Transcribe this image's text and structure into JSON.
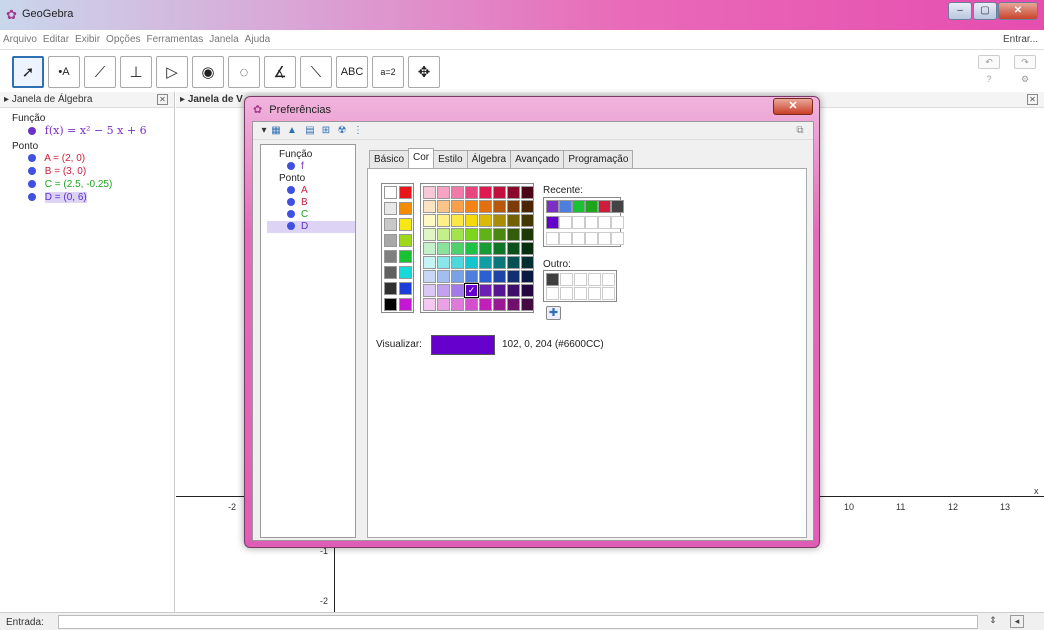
{
  "app": {
    "title": "GeoGebra",
    "login": "Entrar..."
  },
  "menu": [
    "Arquivo",
    "Editar",
    "Exibir",
    "Opções",
    "Ferramentas",
    "Janela",
    "Ajuda"
  ],
  "toolbar": {
    "text_tool": "ABC",
    "slider_tool": "a=2"
  },
  "algebra": {
    "title": "Janela de Álgebra",
    "groups": [
      {
        "label": "Função",
        "items": [
          {
            "text": "f(x) = x² − 5 x + 6",
            "color": "#7b2fc5"
          }
        ]
      },
      {
        "label": "Ponto",
        "items": [
          {
            "text": "A = (2, 0)",
            "color": "#cc1d3c"
          },
          {
            "text": "B = (3, 0)",
            "color": "#cc1d3c"
          },
          {
            "text": "C = (2.5, -0.25)",
            "color": "#1ea51e"
          },
          {
            "text": "D = (0, 6)",
            "color": "#5b2fd0"
          }
        ]
      }
    ]
  },
  "graphics": {
    "title": "Janela de V",
    "x_ticks": [
      "-2",
      "10",
      "11",
      "12",
      "13"
    ],
    "y_ticks": [
      "-1",
      "-2"
    ],
    "x_axis_label": "x"
  },
  "input": {
    "label": "Entrada:"
  },
  "dialog": {
    "title": "Preferências",
    "tree": [
      {
        "label": "Função",
        "children": [
          "f"
        ]
      },
      {
        "label": "Ponto",
        "children": [
          "A",
          "B",
          "C",
          "D"
        ]
      }
    ],
    "tabs": [
      "Básico",
      "Cor",
      "Estilo",
      "Álgebra",
      "Avançado",
      "Programação"
    ],
    "selected_tab": "Cor",
    "recent_label": "Recente:",
    "other_label": "Outro:",
    "preview_label": "Visualizar:",
    "preview_value": "102, 0, 204 (#6600CC)",
    "preview_color": "#6600cc",
    "gray_colors": [
      "#ffffff",
      "#e8e8e8",
      "#c8c8c8",
      "#a8a8a8",
      "#808080",
      "#606060",
      "#303030",
      "#000000"
    ],
    "primary_colors": [
      "#e8161b",
      "#f38c00",
      "#f7e714",
      "#9bd91a",
      "#19c233",
      "#17d9d9",
      "#1b3ed9",
      "#c416d3"
    ],
    "palette_rows": [
      [
        "#f8c8d8",
        "#f7a4c4",
        "#f07aa8",
        "#e8467e",
        "#e01a4f",
        "#c0103e",
        "#8a0a2b",
        "#4b0618"
      ],
      [
        "#fde3c4",
        "#fcc487",
        "#f9a04a",
        "#f58313",
        "#e36f0d",
        "#b7580a",
        "#7d3c07",
        "#4a2404"
      ],
      [
        "#fff7c4",
        "#fff08a",
        "#fde744",
        "#f7d80c",
        "#dbb80a",
        "#a98c08",
        "#736005",
        "#433703"
      ],
      [
        "#dff7c4",
        "#c4f08a",
        "#a2e44b",
        "#7ed61c",
        "#61b214",
        "#4a8810",
        "#335d0b",
        "#1e3706"
      ],
      [
        "#c4f0cc",
        "#8ae29c",
        "#4fd06c",
        "#1ec244",
        "#179b35",
        "#117528",
        "#0b501b",
        "#062f10"
      ],
      [
        "#c4f4f4",
        "#8ae6e9",
        "#4ed8dd",
        "#13c5cc",
        "#0f9ea3",
        "#0b777b",
        "#075154",
        "#042f31"
      ],
      [
        "#c8d8f4",
        "#a2bdee",
        "#7aa0e6",
        "#4e7fdd",
        "#2b5fd4",
        "#1e44a8",
        "#142e74",
        "#0b1a44"
      ],
      [
        "#dcc8f4",
        "#c2a2ee",
        "#a37ae6",
        "#6600cc",
        "#6b1fb5",
        "#561592",
        "#3e0e6a",
        "#260841"
      ],
      [
        "#f4c8f0",
        "#eaa2e6",
        "#e07ada",
        "#d44ecd",
        "#c21fb9",
        "#9b1893",
        "#70106a",
        "#440a41"
      ]
    ],
    "recent_colors": [
      "#7b2fc5",
      "#4e7fdd",
      "#19c233",
      "#1ea51e",
      "#cc1d3c",
      "#444444",
      "#6600cc"
    ],
    "other_colors": [
      "#404040"
    ]
  }
}
